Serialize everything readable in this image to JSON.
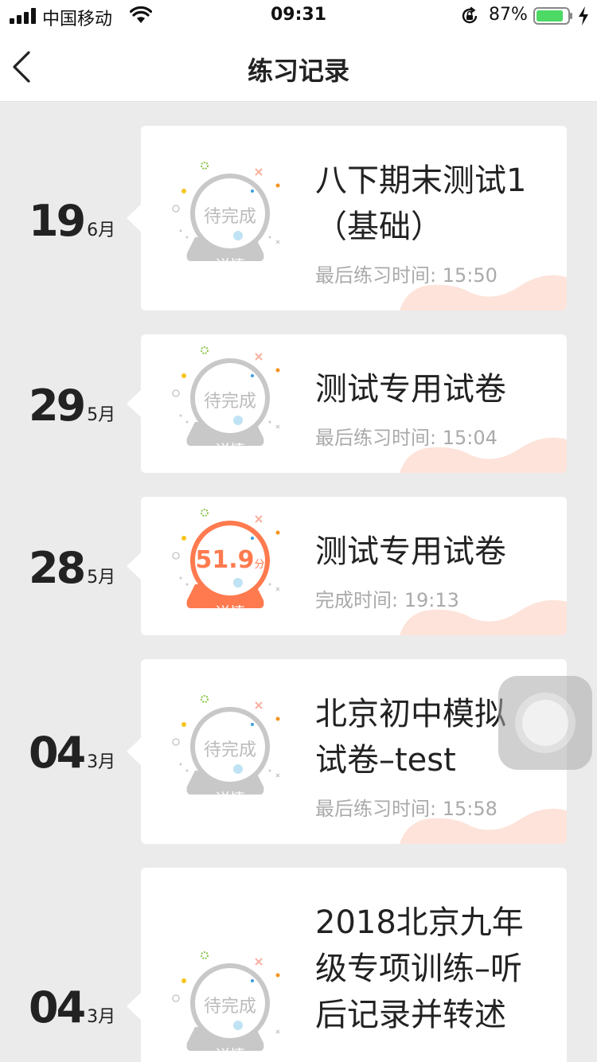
{
  "status_bar": {
    "carrier": "中国移动",
    "time": "09:31",
    "battery_percent": "87%",
    "battery_level": 0.87,
    "battery_color": "#4cd964"
  },
  "nav": {
    "title": "练习记录",
    "back_icon": "chevron-left-icon"
  },
  "colors": {
    "accent": "#ff7a4f",
    "pending": "#c8c8c8",
    "wave": "#fde3da"
  },
  "records": [
    {
      "day": "19",
      "month": "6月",
      "status": "pending",
      "badge_text": "待完成",
      "badge_label": "详情",
      "title": "八下期末测试1（基础）",
      "time_text": "最后练习时间: 15:50"
    },
    {
      "day": "29",
      "month": "5月",
      "status": "pending",
      "badge_text": "待完成",
      "badge_label": "详情",
      "title": "测试专用试卷",
      "time_text": "最后练习时间: 15:04"
    },
    {
      "day": "28",
      "month": "5月",
      "status": "done",
      "badge_text": "51.9",
      "badge_unit": "分",
      "badge_label": "详情",
      "title": "测试专用试卷",
      "time_text": "完成时间: 19:13"
    },
    {
      "day": "04",
      "month": "3月",
      "status": "pending",
      "badge_text": "待完成",
      "badge_label": "详情",
      "title": "北京初中模拟试卷–test",
      "time_text": "最后练习时间: 15:58"
    },
    {
      "day": "04",
      "month": "3月",
      "status": "pending",
      "badge_text": "待完成",
      "badge_label": "详情",
      "title": "2018北京九年级专项训练–听后记录并转述",
      "time_text": ""
    }
  ]
}
